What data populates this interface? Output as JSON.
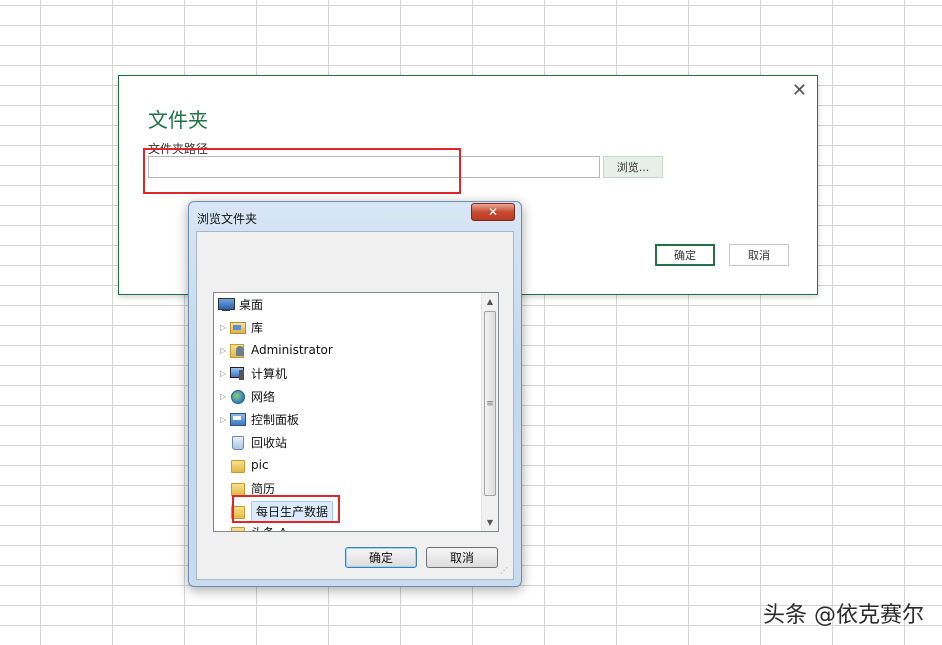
{
  "folder_dialog": {
    "title": "文件夹",
    "path_label": "文件夹路径",
    "path_value": "",
    "browse_label": "浏览...",
    "ok_label": "确定",
    "cancel_label": "取消",
    "close_glyph": "✕",
    "accent_color": "#217346"
  },
  "browse_dialog": {
    "title": "浏览文件夹",
    "close_glyph": "✕",
    "tree": [
      {
        "label": "桌面",
        "icon": "desktop-icon",
        "expandable": false
      },
      {
        "label": "库",
        "icon": "library-folder-icon",
        "expandable": true
      },
      {
        "label": "Administrator",
        "icon": "user-folder-icon",
        "expandable": true
      },
      {
        "label": "计算机",
        "icon": "computer-icon",
        "expandable": true
      },
      {
        "label": "网络",
        "icon": "network-icon",
        "expandable": true
      },
      {
        "label": "控制面板",
        "icon": "control-panel-icon",
        "expandable": true
      },
      {
        "label": "回收站",
        "icon": "recycle-bin-icon",
        "expandable": false
      },
      {
        "label": "pic",
        "icon": "folder-icon",
        "expandable": false
      },
      {
        "label": "简历",
        "icon": "folder-icon",
        "expandable": false
      },
      {
        "label": "每日生产数据",
        "icon": "folder-icon",
        "expandable": false,
        "selected": true
      },
      {
        "label": "头条 A...",
        "icon": "folder-icon",
        "expandable": false
      }
    ],
    "ok_label": "确定",
    "cancel_label": "取消"
  },
  "highlight_color": "#e0252b",
  "watermark": "头条 @依克赛尔"
}
